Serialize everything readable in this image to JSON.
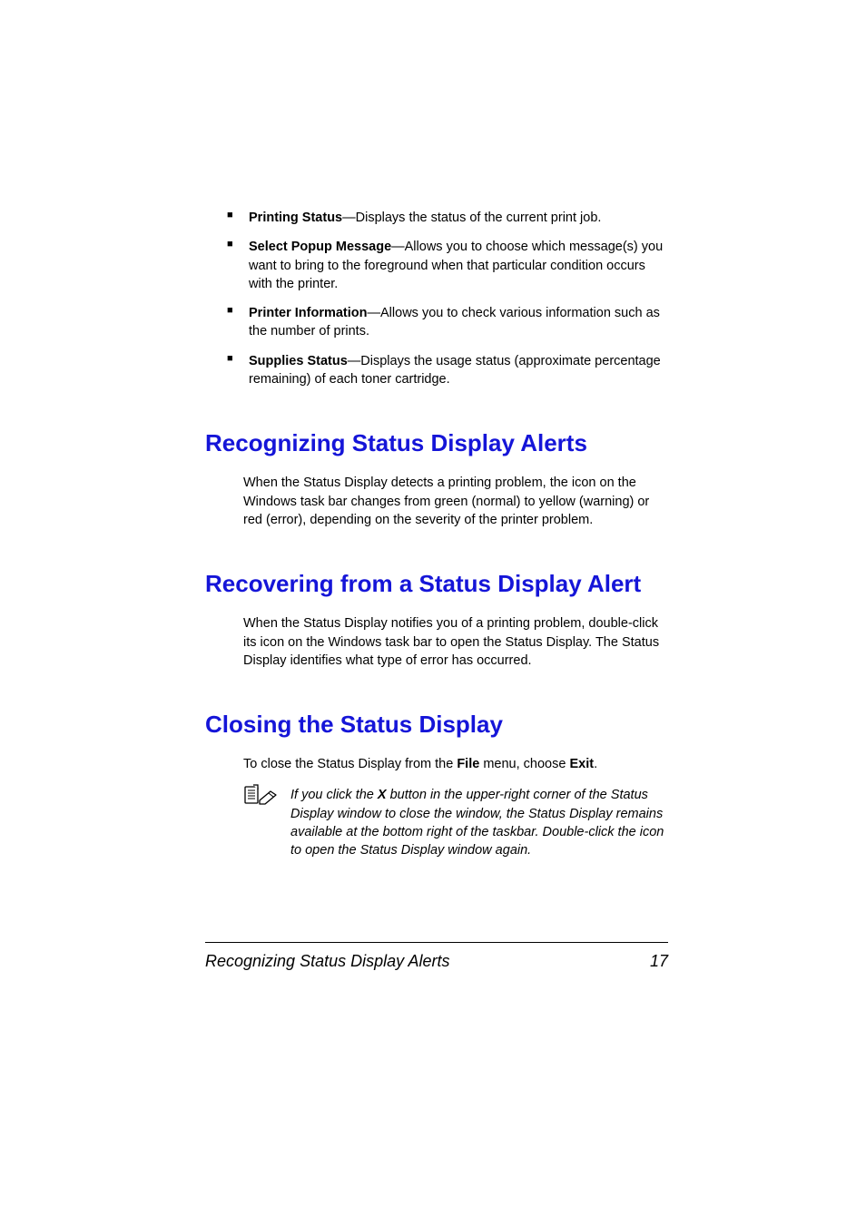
{
  "bullets": [
    {
      "label": "Printing Status",
      "desc": "—Displays the status of the current print job."
    },
    {
      "label": "Select Popup Message",
      "desc": "—Allows you to choose which message(s) you want to bring to the foreground when that particular condition occurs with the printer."
    },
    {
      "label": "Printer Information",
      "desc": "—Allows you to check various information such as the number of prints."
    },
    {
      "label": "Supplies Status",
      "desc": "—Displays the usage status (approximate percentage remaining) of each toner cartridge."
    }
  ],
  "sections": {
    "recognizing": {
      "heading": "Recognizing Status Display Alerts",
      "body": "When the Status Display detects a printing problem, the icon on the Windows task bar changes from green (normal) to yellow (warning) or red (error), depending on the severity of the printer problem."
    },
    "recovering": {
      "heading": "Recovering from a Status Display Alert",
      "body": "When the Status Display notifies you of a printing problem, double-click its icon on the Windows task bar to open the Status Display. The Status Display identifies what type of error has occurred."
    },
    "closing": {
      "heading": "Closing the Status Display",
      "body_prefix": "To close the Status Display from the ",
      "body_bold1": "File",
      "body_mid": " menu, choose ",
      "body_bold2": "Exit",
      "body_suffix": ".",
      "note_prefix": "If you click the ",
      "note_bold": "X",
      "note_suffix": " button in the upper-right corner of the Status Display window to close the window, the Status Display remains available at the bottom right of the taskbar. Double-click the icon to open the Status Display window again."
    }
  },
  "footer": {
    "title": "Recognizing Status Display Alerts",
    "page": "17"
  }
}
